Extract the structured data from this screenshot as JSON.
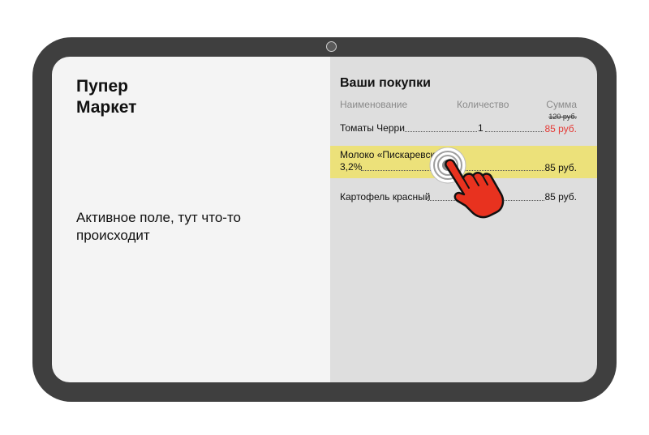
{
  "store": {
    "title": "Пупер\nМаркет"
  },
  "left": {
    "active_text": "Активное поле, тут что-то происходит"
  },
  "cart": {
    "title": "Ваши покупки",
    "columns": {
      "name": "Наименование",
      "qty": "Количество",
      "sum": "Сумма"
    },
    "items": [
      {
        "name": "Томаты Черри",
        "qty": "1",
        "old_price": "120 руб.",
        "price": "85 руб."
      },
      {
        "name_line1": "Молоко «Пискаревское»",
        "name_line2": "3,2%",
        "price": "85 руб."
      },
      {
        "name": "Картофель красный",
        "price": "85 руб."
      }
    ]
  },
  "colors": {
    "frame": "#3f3f3f",
    "highlight": "#ece17a",
    "discount_price": "#e53935",
    "hand": "#e8321f"
  },
  "icons": {
    "cursor": "tap-hand-icon",
    "camera": "camera-icon"
  }
}
